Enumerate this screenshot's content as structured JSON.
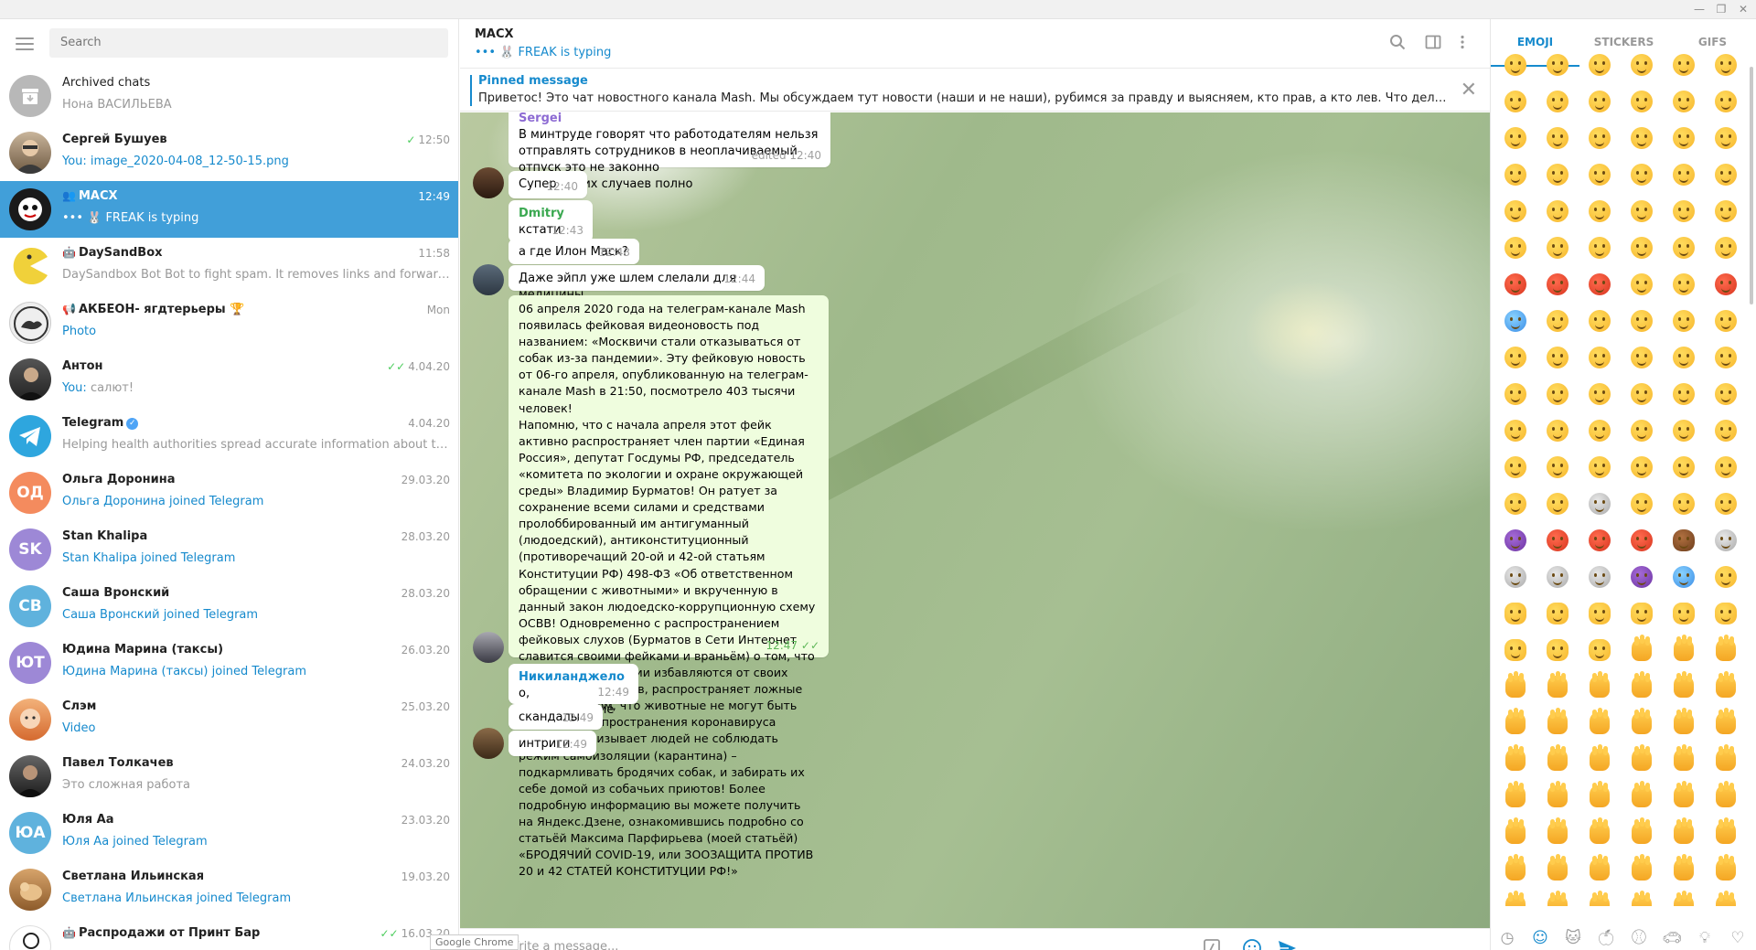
{
  "search": {
    "placeholder": "Search"
  },
  "chats": [
    {
      "name": "Archived chats",
      "time": "",
      "preview": "Нона ВАСИЛЬЕВА",
      "avatar_text": "",
      "avatar_color": "#b8b8b8",
      "preview_blue": false,
      "ticks": ""
    },
    {
      "name": "Сергей Бушуев",
      "time": "12:50",
      "preview": "You: image_2020-04-08_12-50-15.png",
      "avatar_text": "",
      "avatar_color": "#7b6a55",
      "preview_blue": true,
      "ticks": "✓"
    },
    {
      "name": "MACX",
      "time": "12:49",
      "preview": "••• 🐰 FREAK is typing",
      "avatar_text": "",
      "avatar_color": "#1a1a1a",
      "preview_blue": true,
      "ticks": "",
      "active": true
    },
    {
      "name": "DaySandBox",
      "time": "11:58",
      "preview": "DaySandbox Bot  Bot to fight spam. It removes links and forwarded ...",
      "avatar_text": "",
      "avatar_color": "#f0d13a",
      "preview_blue": false,
      "ticks": ""
    },
    {
      "name": "АКБЕОН- ягдтерьеры 🏆",
      "time": "Mon",
      "preview": "Photo",
      "avatar_text": "",
      "avatar_color": "#d9d9d9",
      "preview_blue": true,
      "ticks": ""
    },
    {
      "name": "Антон",
      "time": "4.04.20",
      "preview": "You: салют!",
      "avatar_text": "",
      "avatar_color": "#3a3a3a",
      "preview_blue": false,
      "ticks": "✓✓"
    },
    {
      "name": "Telegram",
      "time": "4.04.20",
      "preview": "Helping health authorities spread accurate information about the pan...",
      "avatar_text": "",
      "avatar_color": "#2ea6de",
      "preview_blue": false,
      "ticks": ""
    },
    {
      "name": "Ольга Доронина",
      "time": "29.03.20",
      "preview": "Ольга Доронина joined Telegram",
      "avatar_text": "ОД",
      "avatar_color": "#f48b5e",
      "preview_blue": true,
      "ticks": ""
    },
    {
      "name": "Stan Khalipa",
      "time": "28.03.20",
      "preview": "Stan Khalipa joined Telegram",
      "avatar_text": "SK",
      "avatar_color": "#9d88d6",
      "preview_blue": true,
      "ticks": ""
    },
    {
      "name": "Саша Вронский",
      "time": "28.03.20",
      "preview": "Саша Вронский joined Telegram",
      "avatar_text": "СВ",
      "avatar_color": "#5fb2dd",
      "preview_blue": true,
      "ticks": ""
    },
    {
      "name": "Юдина Марина (таксы)",
      "time": "26.03.20",
      "preview": "Юдина Марина (таксы) joined Telegram",
      "avatar_text": "ЮТ",
      "avatar_color": "#9d88d6",
      "preview_blue": true,
      "ticks": ""
    },
    {
      "name": "Слэм",
      "time": "25.03.20",
      "preview": "Video",
      "avatar_text": "",
      "avatar_color": "#e58a4a",
      "preview_blue": true,
      "ticks": ""
    },
    {
      "name": "Павел Толкачев",
      "time": "24.03.20",
      "preview": "Это сложная работа",
      "avatar_text": "",
      "avatar_color": "#2c2c2c",
      "preview_blue": false,
      "ticks": ""
    },
    {
      "name": "Юля Аа",
      "time": "23.03.20",
      "preview": "Юля Аа joined Telegram",
      "avatar_text": "ЮА",
      "avatar_color": "#5fb2dd",
      "preview_blue": true,
      "ticks": ""
    },
    {
      "name": "Светлана Ильинская",
      "time": "19.03.20",
      "preview": "Светлана Ильинская joined Telegram",
      "avatar_text": "",
      "avatar_color": "#c88a54",
      "preview_blue": true,
      "ticks": ""
    },
    {
      "name": "Распродажи от Принт Бар",
      "time": "16.03.20",
      "preview": "",
      "avatar_text": "",
      "avatar_color": "#ffffff",
      "preview_blue": false,
      "ticks": "✓✓"
    }
  ],
  "header": {
    "title": "MACX",
    "status": "••• 🐰 FREAK is typing"
  },
  "pinned": {
    "label": "Pinned message",
    "text": "Приветос! Это чат новостного канала Mash. Мы обсуждаем тут новости (наши и не наши), рубимся за правду и выясняем, кто прав, а кто лев.   Что делать нельзя? На..."
  },
  "messages": [
    {
      "sender": "Sergei",
      "text": "В минтруде говорят что работодателям нельзя отправлять сотрудников в неоплачиваемый отпуск это не законно\nОднако этих случаев полно",
      "time": "edited 12:40"
    },
    {
      "sender": "",
      "text": "Супер",
      "time": "12:40"
    },
    {
      "sender": "Dmitry",
      "text": "кстати",
      "time": "12:43"
    },
    {
      "sender": "",
      "text": "а где Илон Маск?",
      "time": "12:43"
    },
    {
      "sender": "",
      "text": "Даже эйпл уже шлем слелали для медицины",
      "time": "12:44"
    },
    {
      "sender": "",
      "text": "06 апреля 2020 года на телеграм-канале Mash появилась фейковая видеоновость под названием: «Москвичи стали отказываться от собак из-за пандемии». Эту фейковую новость от 06-го апреля, опубликованную на телеграм-канале Mash в 21:50, посмотрело 403 тысячи человек!\nНапомню, что с начала апреля этот фейк активно распространяет член партии «Единая Россия», депутат Госдумы РФ, председатель «комитета по экологии и охране окружающей среды» Владимир Бурматов! Он ратует за сохранение всеми силами и средствами пролоббированный им антигуманный (людоедский), антиконституционный (противоречащий 20-ой и 42-ой статьям Конституции РФ) 498-ФЗ «Об ответственном обращении с животными» и вкрученную в данный закон людоедско-коррупционную схему ОСВВ! Одновременно с распространением фейковых слухов (Бурматов в Сети Интернет славится своими фейками и враньём) о том, что люди из-за пандемии избавляются от своих домашних питомцев, распространяет ложные сведения о том, что животные не могут быть причиной распространения коронавируса COVID-19, призывает людей не соблюдать режим самоизоляции (карантина) – подкармливать бродячих собак, и забирать их себе домой из собачьих приютов! Более подробную информацию вы можете получить на Яндекс.Дзене, ознакомившись подробно со статьёй Максима Парфирьева (моей статьёй) «БРОДЯЧИЙ COVID-19, или ЗООЗАЩИТА ПРОТИВ 20 и 42 СТАТЕЙ КОНСТИТУЦИИ РФ!»",
      "time": "12:47",
      "ticks": "✓✓"
    },
    {
      "sender": "Никиланджело",
      "text": "о, расследование",
      "time": "12:49"
    },
    {
      "sender": "",
      "text": "скандалы",
      "time": "12:49"
    },
    {
      "sender": "",
      "text": "интриги",
      "time": "12:49"
    }
  ],
  "composer": {
    "placeholder": "Write a message...",
    "tooltip": "Google Chrome"
  },
  "panel": {
    "tabs": [
      "EMOJI",
      "STICKERS",
      "GIFS"
    ]
  },
  "colors": {
    "accent": "#419fd9",
    "link": "#168acd",
    "out_bubble": "#effdde"
  },
  "icons": {
    "header": [
      "search-icon",
      "sidebar-toggle-icon",
      "more-vertical-icon"
    ],
    "composer": [
      "attach-icon",
      "bot-command-icon",
      "emoji-icon",
      "send-icon"
    ],
    "emoji_categories": [
      "recent-icon",
      "smileys-icon",
      "animals-icon",
      "food-icon",
      "activity-icon",
      "travel-icon",
      "objects-icon",
      "symbols-icon"
    ]
  }
}
